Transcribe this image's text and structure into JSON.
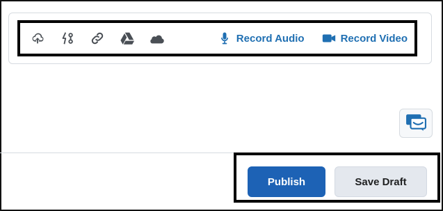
{
  "toolbar": {
    "icons": [
      {
        "name": "upload-cloud-icon"
      },
      {
        "name": "insert-stuff-icon"
      },
      {
        "name": "link-icon"
      },
      {
        "name": "google-drive-icon"
      },
      {
        "name": "onedrive-icon"
      }
    ],
    "record_audio_label": "Record Audio",
    "record_video_label": "Record Video",
    "accent_color": "#1f6fb2"
  },
  "chat": {
    "icon": "feedback-chat-icon"
  },
  "actions": {
    "publish_label": "Publish",
    "save_draft_label": "Save Draft",
    "publish_color": "#1d62b5"
  }
}
